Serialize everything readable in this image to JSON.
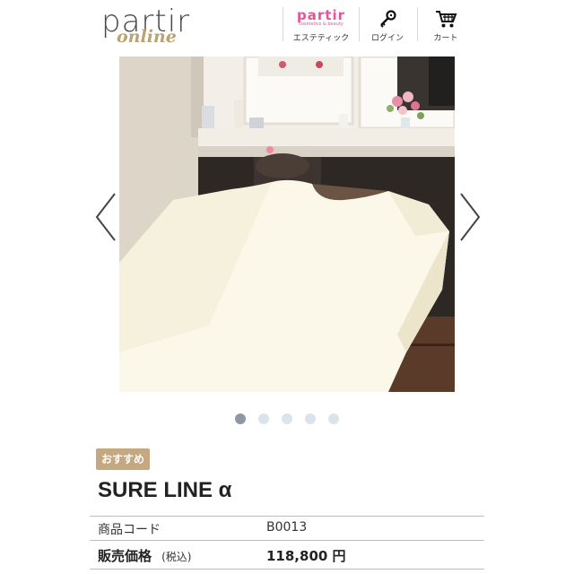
{
  "header": {
    "logo_main": "partir",
    "logo_sub": "online",
    "nav": [
      {
        "brand": "partir",
        "brand_sub": "cosmetics & beauty",
        "label": "エステティック"
      },
      {
        "label": "ログイン"
      },
      {
        "label": "カート"
      }
    ]
  },
  "carousel": {
    "slide_count": 5,
    "active_index": 0
  },
  "product": {
    "badge": "おすすめ",
    "name": "SURE LINE α",
    "code_label": "商品コード",
    "code_value": "B0013",
    "price_label": "販売価格",
    "price_tax_note": "(税込)",
    "price_value": "118,800 円"
  },
  "colors": {
    "accent_gold": "#c5a780",
    "brand_pink": "#e0569a",
    "dot_active": "#8e97a3",
    "dot_inactive": "#dde3ea"
  }
}
